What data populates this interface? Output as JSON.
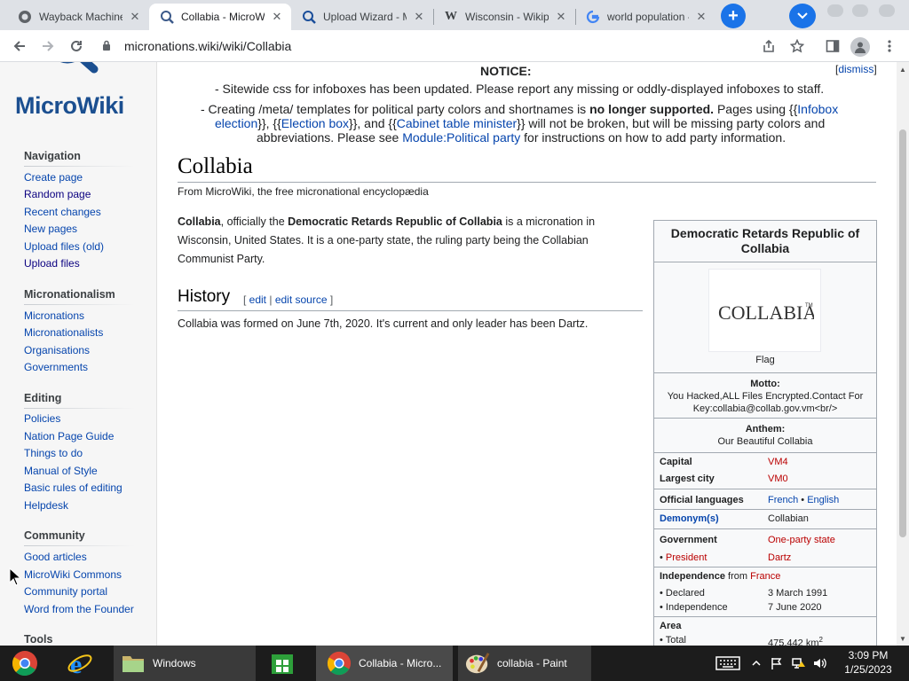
{
  "browser": {
    "tabs": [
      {
        "title": "Wayback Machine",
        "icon": "wayback-icon",
        "active": false
      },
      {
        "title": "Collabia - MicroWiki",
        "icon": "microwiki-icon",
        "active": true
      },
      {
        "title": "Upload Wizard - Mic",
        "icon": "microwiki-icon",
        "active": false
      },
      {
        "title": "Wisconsin - Wikiped",
        "icon": "wikipedia-icon",
        "active": false
      },
      {
        "title": "world population - G",
        "icon": "google-icon",
        "active": false
      }
    ],
    "address": "micronations.wiki/wiki/Collabia"
  },
  "sidebar": {
    "logo": "MicroWiki",
    "sections": [
      {
        "heading": "Navigation",
        "items": [
          "Create page",
          "Random page",
          "Recent changes",
          "New pages",
          "Upload files (old)",
          "Upload files"
        ]
      },
      {
        "heading": "Micronationalism",
        "items": [
          "Micronations",
          "Micronationalists",
          "Organisations",
          "Governments"
        ]
      },
      {
        "heading": "Editing",
        "items": [
          "Policies",
          "Nation Page Guide",
          "Things to do",
          "Manual of Style",
          "Basic rules of editing",
          "Helpdesk"
        ]
      },
      {
        "heading": "Community",
        "items": [
          "Good articles",
          "MicroWiki Commons",
          "Community portal",
          "Word from the Founder"
        ]
      },
      {
        "heading": "Tools",
        "items": []
      }
    ]
  },
  "notice": {
    "title": "NOTICE:",
    "dismiss": "dismiss",
    "line1": "- Sitewide css for infoboxes has been updated. Please report any missing or oddly-displayed infoboxes to staff.",
    "line2a": "- Creating /meta/ templates for political party colors and shortnames is ",
    "line2_bold": "no longer supported.",
    "line2b": " Pages using {{",
    "line2_link": "Infobox",
    "line3_link1": "election",
    "line3a": "}}, {{",
    "line3_link2": "Election box",
    "line3b": "}}, and {{",
    "line3_link3": "Cabinet table minister",
    "line3c": "}} will not be broken, but will be missing party colors and",
    "line4a": "abbreviations. Please see ",
    "line4_link": "Module:Political party",
    "line4b": " for instructions on how to add party information."
  },
  "article": {
    "title": "Collabia",
    "tagline": "From MicroWiki, the free micronational encyclopædia",
    "intro_bold1": "Collabia",
    "intro_t1": ", officially the ",
    "intro_bold2": "Democratic Retards Republic of Collabia",
    "intro_t2": " is a micronation in Wisconsin, United States. It is a one-party state, the ruling party being the Collabian Communist Party.",
    "history_heading": "History",
    "edit_open": "[ ",
    "edit": "edit",
    "edit_sep": " | ",
    "edit_source": "edit source",
    "edit_close": " ]",
    "history_text": "Collabia was formed on June 7th, 2020. It's current and only leader has been Dartz."
  },
  "infobox": {
    "title": "Democratic Retards Republic of Collabia",
    "flag_text": "COLLABIA",
    "flag_tm": "TM",
    "flag_caption": "Flag",
    "motto_label": "Motto:",
    "motto": "You Hacked,ALL Files Encrypted.Contact For Key:collabia@collab.gov.vm<br/>",
    "anthem_label": "Anthem:",
    "anthem": "Our Beautiful Collabia",
    "capital_label": "Capital",
    "capital": "VM4",
    "largest_city_label": "Largest city",
    "largest_city": "VM0",
    "languages_label": "Official languages",
    "language1": "French",
    "language_sep": " • ",
    "language2": "English",
    "demonym_label": "Demonym(s)",
    "demonym": "Collabian",
    "government_label": "Government",
    "government": "One-party state",
    "president_bullet": "• ",
    "president_label": "President",
    "president": "Dartz",
    "independence_label": "Independence",
    "independence_from": " from ",
    "independence_country": "France",
    "declared_label": "• Declared",
    "declared": "3 March 1991",
    "independence_sub_label": "• Independence",
    "independence_date": "7 June 2020",
    "area_label": "Area",
    "total_label": "• Total",
    "total": "475,442 km",
    "total_sup": "2"
  },
  "taskbar": {
    "apps": [
      {
        "label": "",
        "icon": "chrome-icon"
      },
      {
        "label": "",
        "icon": "ie-icon"
      },
      {
        "label": "Windows",
        "icon": "folder-icon"
      },
      {
        "label": "",
        "icon": "store-icon"
      },
      {
        "label": "Collabia - Micro...",
        "icon": "chrome-icon"
      },
      {
        "label": "collabia - Paint",
        "icon": "paint-icon"
      }
    ],
    "time": "3:09 PM",
    "date": "1/25/2023"
  },
  "colors": {
    "link": "#0645ad",
    "redlink": "#ba0000",
    "chrome_blue": "#1a73e8",
    "logo_blue": "#1b4f90"
  }
}
